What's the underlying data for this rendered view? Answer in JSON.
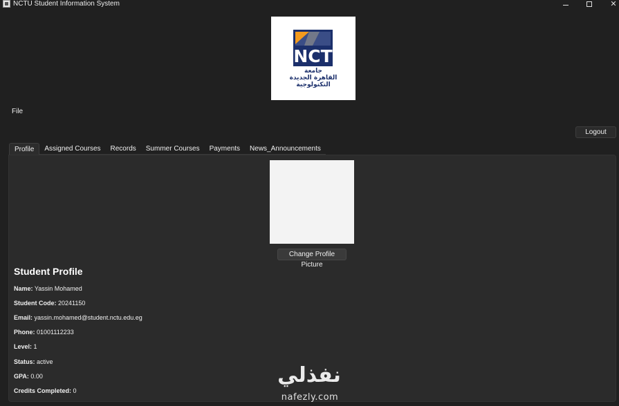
{
  "window": {
    "title": "NCTU Student Information System",
    "controls": {
      "minimize": "",
      "maximize": "",
      "close": "✕"
    }
  },
  "logo": {
    "brand": "NCT",
    "arabic_line1": "جامعة",
    "arabic_line2": "القاهرة الجديدة",
    "arabic_line3": "التكنولوجية",
    "colors": {
      "navy": "#1b2f6b",
      "orange": "#f39a1e",
      "grey": "#8a8a8a"
    }
  },
  "menu": {
    "file": "File"
  },
  "header": {
    "logout_label": "Logout"
  },
  "tabs": [
    {
      "label": "Profile",
      "active": true
    },
    {
      "label": "Assigned Courses",
      "active": false
    },
    {
      "label": "Records",
      "active": false
    },
    {
      "label": "Summer Courses",
      "active": false
    },
    {
      "label": "Payments",
      "active": false
    },
    {
      "label": "News_Announcements",
      "active": false
    }
  ],
  "profile": {
    "change_picture_label": "Change Profile Picture",
    "heading": "Student Profile",
    "fields": [
      {
        "label": "Name:",
        "value": "Yassin Mohamed"
      },
      {
        "label": "Student Code:",
        "value": "20241150"
      },
      {
        "label": "Email:",
        "value": "yassin.mohamed@student.nctu.edu.eg"
      },
      {
        "label": "Phone:",
        "value": "01001112233"
      },
      {
        "label": "Level:",
        "value": "1"
      },
      {
        "label": "Status:",
        "value": "active"
      },
      {
        "label": "GPA:",
        "value": "0.00"
      },
      {
        "label": "Credits Completed:",
        "value": "0"
      }
    ]
  },
  "watermark": {
    "arabic": "نفذلي",
    "latin": "nafezly.com"
  }
}
